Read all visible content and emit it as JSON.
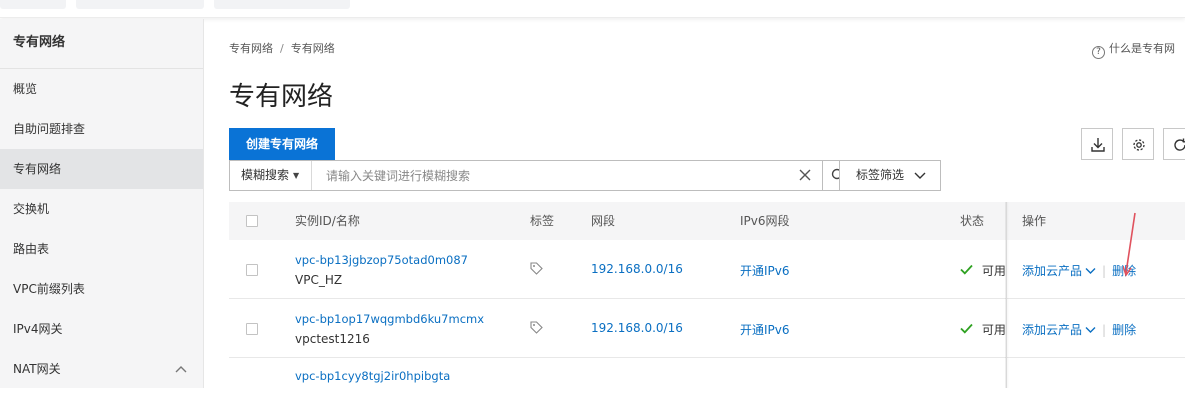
{
  "sidebar": {
    "title": "专有网络",
    "items": [
      {
        "label": "概览"
      },
      {
        "label": "自助问题排查"
      },
      {
        "label": "专有网络"
      },
      {
        "label": "交换机"
      },
      {
        "label": "路由表"
      },
      {
        "label": "VPC前缀列表"
      },
      {
        "label": "IPv4网关"
      },
      {
        "label": "NAT网关"
      }
    ]
  },
  "breadcrumb": [
    "专有网络",
    "专有网络"
  ],
  "help_link": "什么是专有网",
  "page_title": "专有网络",
  "toolbar": {
    "create_label": "创建专有网络",
    "search_type": "模糊搜索",
    "search_placeholder": "请输入关键词进行模糊搜索",
    "tag_filter_label": "标签筛选"
  },
  "table": {
    "columns": [
      "实例ID/名称",
      "标签",
      "网段",
      "IPv6网段",
      "状态",
      "操作"
    ],
    "rows": [
      {
        "id": "vpc-bp13jgbzop75otad0m087",
        "name": "VPC_HZ",
        "cidr": "192.168.0.0/16",
        "ipv6": "开通IPv6",
        "status": "可用",
        "add_product": "添加云产品",
        "delete": "删除"
      },
      {
        "id": "vpc-bp1op17wqgmbd6ku7mcmx",
        "name": "vpctest1216",
        "cidr": "192.168.0.0/16",
        "ipv6": "开通IPv6",
        "status": "可用",
        "add_product": "添加云产品",
        "delete": "删除"
      },
      {
        "id": "vpc-bp1cyy8tgj2ir0hpibgta"
      }
    ]
  },
  "colors": {
    "primary": "#0a73d6",
    "link": "#0a6fc2",
    "success": "#2ea121",
    "annotation": "#e0525e"
  }
}
